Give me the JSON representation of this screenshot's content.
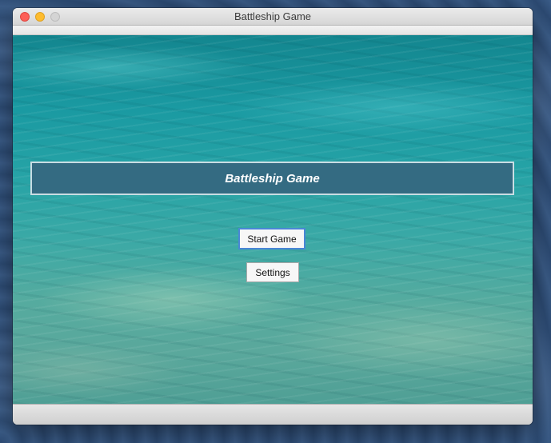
{
  "window": {
    "title": "Battleship Game"
  },
  "main": {
    "banner_title": "Battleship Game",
    "start_button_label": "Start Game",
    "settings_button_label": "Settings"
  },
  "colors": {
    "banner_background": "#346b82",
    "focus_ring": "#4a86d6"
  }
}
